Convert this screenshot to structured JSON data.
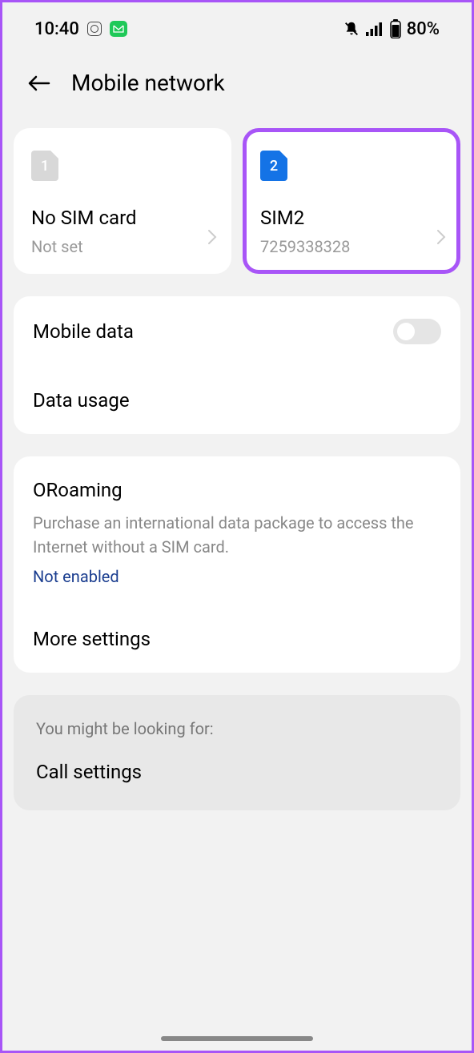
{
  "statusBar": {
    "time": "10:40",
    "battery": "80%"
  },
  "header": {
    "title": "Mobile network"
  },
  "simCards": [
    {
      "number": "1",
      "title": "No SIM card",
      "subtitle": "Not set"
    },
    {
      "number": "2",
      "title": "SIM2",
      "subtitle": "7259338328"
    }
  ],
  "settings": {
    "mobileData": "Mobile data",
    "dataUsage": "Data usage"
  },
  "roaming": {
    "title": "ORoaming",
    "description": "Purchase an international data package to access the Internet without a SIM card.",
    "status": "Not enabled",
    "moreSettings": "More settings"
  },
  "suggestion": {
    "hint": "You might be looking for:",
    "label": "Call settings"
  }
}
